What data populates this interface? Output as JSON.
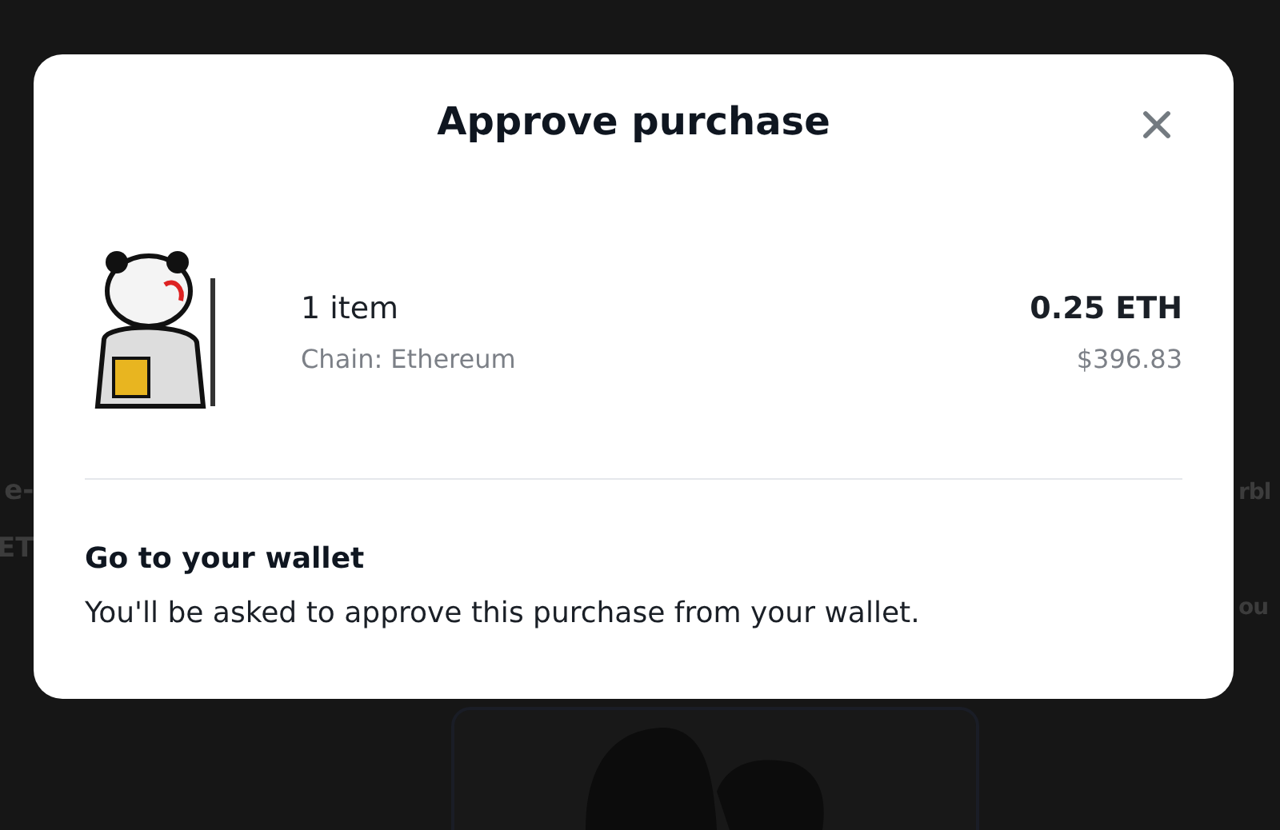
{
  "background": {
    "left_fragments": [
      "e-",
      "ET"
    ],
    "right_fragments": [
      "rbl",
      "ou"
    ]
  },
  "dialog": {
    "title": "Approve purchase",
    "item": {
      "count": "1 item",
      "chain": "Chain: Ethereum",
      "price": "0.25 ETH",
      "usd": "$396.83"
    },
    "heading": "Go to your wallet",
    "message": "You'll be asked to approve this purchase from your wallet."
  }
}
